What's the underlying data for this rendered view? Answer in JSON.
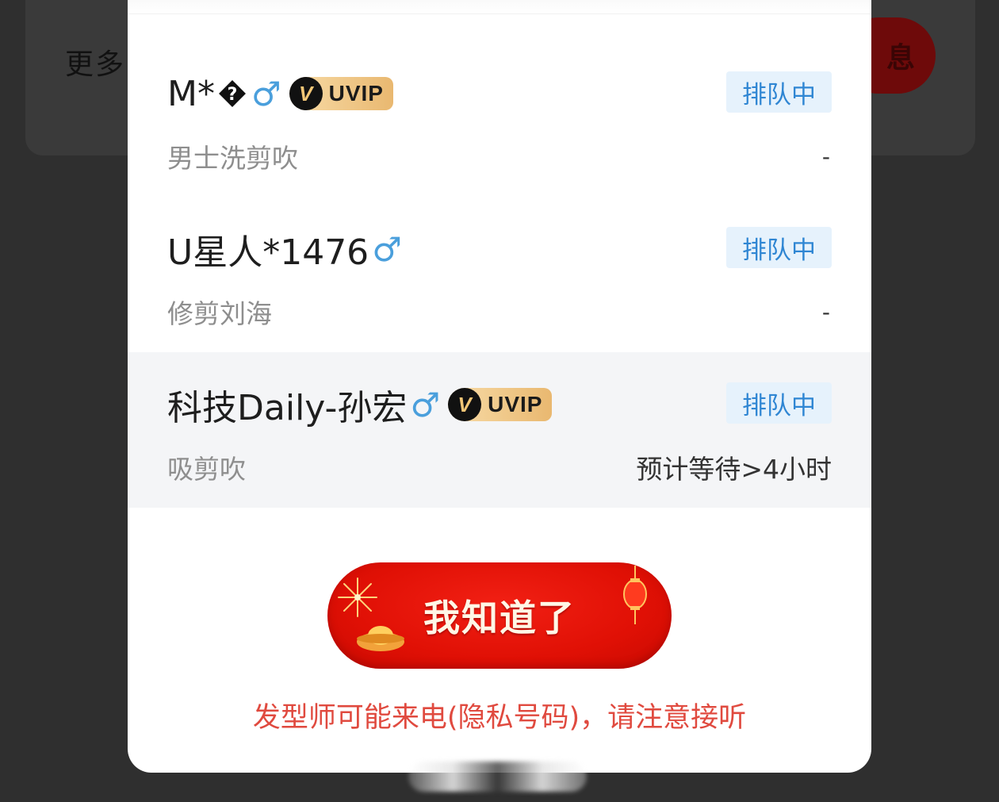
{
  "background": {
    "more_label": "更多",
    "button_label": "息"
  },
  "queue": [
    {
      "name": "M*",
      "name_suffix_glyph": "?",
      "gender_symbol": "♂",
      "vip_badge": "UVIP",
      "has_vip": true,
      "status": "排队中",
      "service": "男士洗剪吹",
      "wait": "-",
      "highlighted": false
    },
    {
      "name": "U星人*1476",
      "gender_symbol": "♂",
      "has_vip": false,
      "status": "排队中",
      "service": "修剪刘海",
      "wait": "-",
      "highlighted": false
    },
    {
      "name": "科技Daily-孙宏",
      "gender_symbol": "♂",
      "vip_badge": "UVIP",
      "has_vip": true,
      "status": "排队中",
      "service": "吸剪吹",
      "wait": "预计等待>4小时",
      "highlighted": true
    }
  ],
  "confirm_button": "我知道了",
  "note": "发型师可能来电(隐私号码)，请注意接听",
  "colors": {
    "status_text": "#2f86d3",
    "status_bg": "#e6f2fc",
    "male_icon": "#4a9fdc",
    "cta_red": "#e01005",
    "note_red": "#e04a3f"
  },
  "icons": [
    "male-icon",
    "vip-badge-icon",
    "firework-icon",
    "gold-ingot-icon",
    "lantern-icon"
  ]
}
